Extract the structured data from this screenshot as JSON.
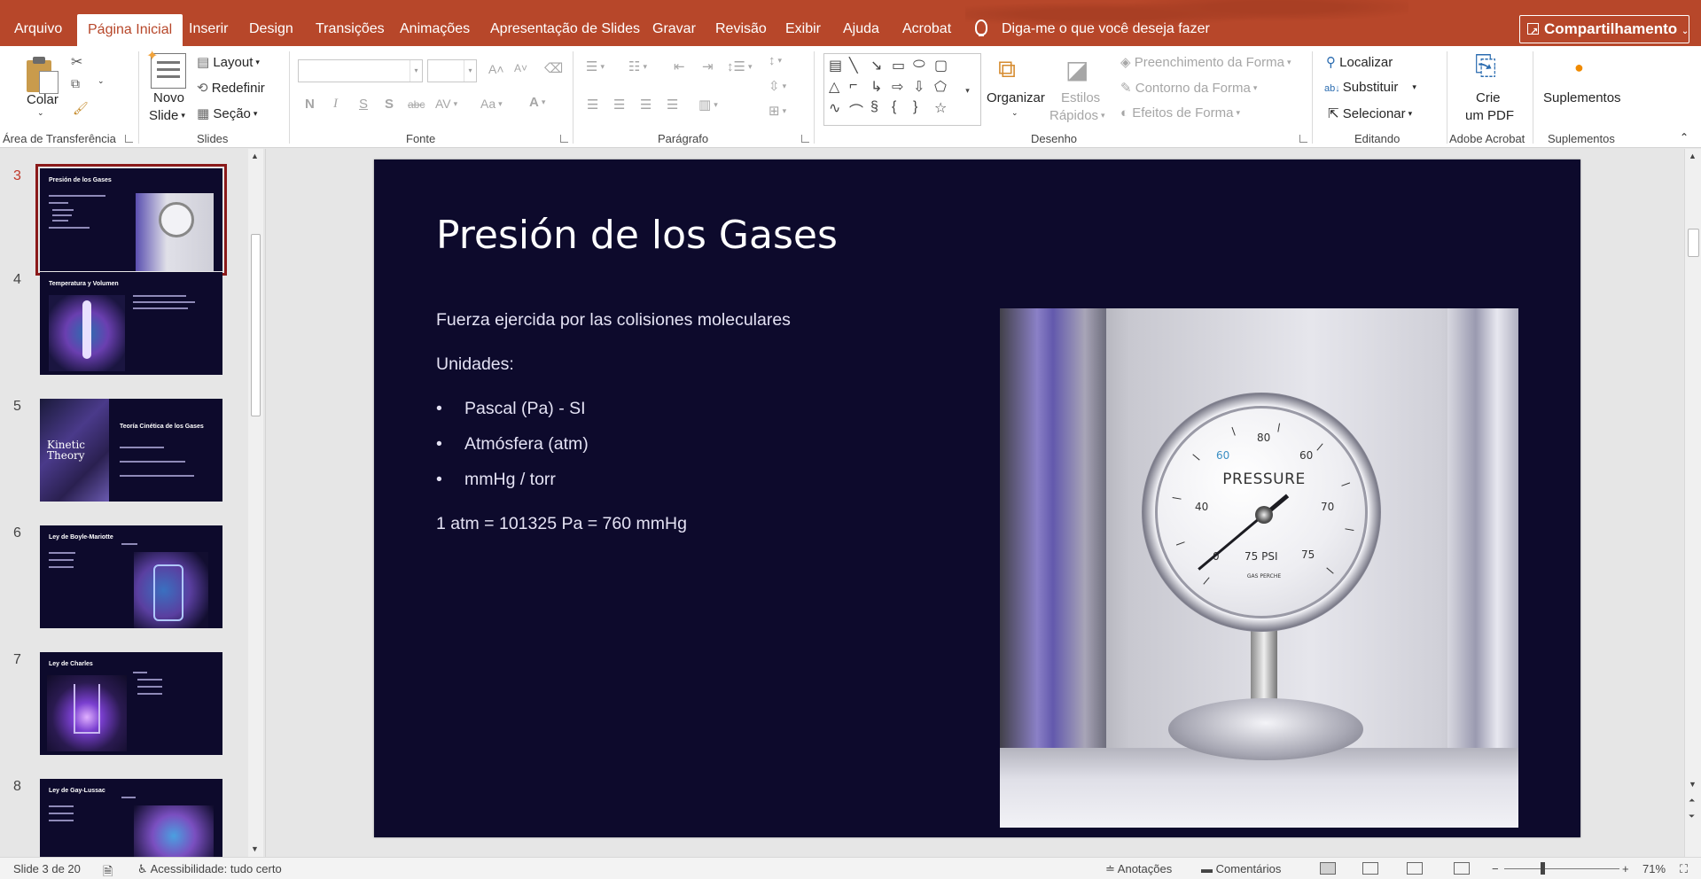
{
  "menu": {
    "items": [
      {
        "label": "Arquivo",
        "active": false
      },
      {
        "label": "Página Inicial",
        "active": true
      },
      {
        "label": "Inserir",
        "active": false
      },
      {
        "label": "Design",
        "active": false
      },
      {
        "label": "Transições",
        "active": false
      },
      {
        "label": "Animações",
        "active": false
      },
      {
        "label": "Apresentação de Slides",
        "active": false
      },
      {
        "label": "Gravar",
        "active": false
      },
      {
        "label": "Revisão",
        "active": false
      },
      {
        "label": "Exibir",
        "active": false
      },
      {
        "label": "Ajuda",
        "active": false
      },
      {
        "label": "Acrobat",
        "active": false
      }
    ],
    "tell_me": "Diga-me o que você deseja fazer",
    "share": "Compartilhamento"
  },
  "ribbon": {
    "clipboard": {
      "paste": "Colar",
      "label": "Área de Transferência"
    },
    "slides": {
      "new_slide_line1": "Novo",
      "new_slide_line2": "Slide",
      "layout": "Layout",
      "reset": "Redefinir",
      "section": "Seção",
      "label": "Slides"
    },
    "font": {
      "label": "Fonte"
    },
    "paragraph": {
      "label": "Parágrafo"
    },
    "drawing": {
      "arrange": "Organizar",
      "quick_styles_line1": "Estilos",
      "quick_styles_line2": "Rápidos",
      "shape_fill": "Preenchimento da Forma",
      "shape_outline": "Contorno da Forma",
      "shape_effects": "Efeitos de Forma",
      "label": "Desenho"
    },
    "editing": {
      "find": "Localizar",
      "replace": "Substituir",
      "select": "Selecionar",
      "label": "Editando"
    },
    "acrobat": {
      "create_pdf_line1": "Crie",
      "create_pdf_line2": "um PDF",
      "label": "Adobe Acrobat"
    },
    "addins": {
      "addins": "Suplementos",
      "label": "Suplementos"
    }
  },
  "thumbnails": [
    {
      "number": "3",
      "title": "Presión de los Gases",
      "active": true
    },
    {
      "number": "4",
      "title": "Temperatura y Volumen",
      "active": false
    },
    {
      "number": "5",
      "title": "Teoría Cinética de los Gases",
      "image_text": "Kinetic Theory",
      "active": false
    },
    {
      "number": "6",
      "title": "Ley de Boyle-Mariotte",
      "active": false
    },
    {
      "number": "7",
      "title": "Ley de Charles",
      "active": false
    },
    {
      "number": "8",
      "title": "Ley de Gay-Lussac",
      "active": false
    }
  ],
  "slide": {
    "title": "Presión de los Gases",
    "intro": "Fuerza ejercida por las colisiones moleculares",
    "units_heading": "Unidades:",
    "bullets": [
      "Pascal (Pa) - SI",
      "Atmósfera (atm)",
      "mmHg / torr"
    ],
    "equivalence": "1 atm = 101325 Pa = 760 mmHg",
    "image": {
      "dial_label": "PRESSURE",
      "psi_label": "75 PSI",
      "small_label": "GAS PERCHE",
      "numbers": [
        "0",
        "40",
        "60",
        "80",
        "60",
        "70",
        "75"
      ]
    }
  },
  "status": {
    "slide_counter": "Slide 3 de 20",
    "accessibility": "Acessibilidade: tudo certo",
    "notes": "Anotações",
    "comments": "Comentários",
    "zoom": "71%"
  },
  "colors": {
    "brand": "#b7472a",
    "slide_bg": "#0d0a2c",
    "active_thumb": "#8b1a1a"
  }
}
